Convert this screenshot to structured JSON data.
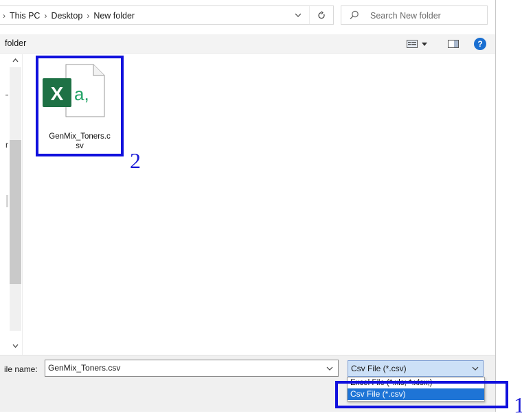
{
  "address": {
    "crumbs": [
      "This PC",
      "Desktop",
      "New folder"
    ],
    "separator": "›",
    "search_placeholder": "Search New folder"
  },
  "toolbar": {
    "new_folder_label": "folder",
    "help_label": "?"
  },
  "nav": {
    "partial_label": "r"
  },
  "file": {
    "name": "GenMix_Toners.csv",
    "icon_letter": "X",
    "icon_badge": "a,",
    "label_line1": "GenMix_Toners.c",
    "label_line2": "sv"
  },
  "bottom": {
    "filename_label": "ile name:",
    "filename_value": "GenMix_Toners.csv",
    "filetype_selected": "Csv File (*.csv)",
    "filetype_options": [
      "Excel File (*.xls; *.xlsx;)",
      "Csv File (*.csv)"
    ]
  },
  "annotations": {
    "box1_number": "1",
    "box2_number": "2"
  },
  "colors": {
    "accent": "#1e74d6",
    "annotation": "#1010dd",
    "excel_green": "#1e7145"
  }
}
